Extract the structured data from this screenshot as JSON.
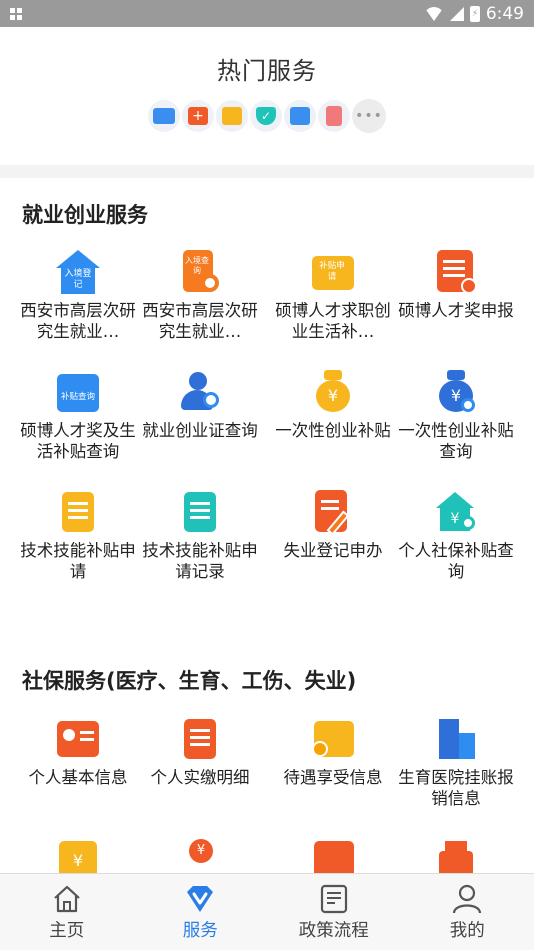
{
  "status_bar": {
    "time": "6:49"
  },
  "hot": {
    "title": "热门服务",
    "icons": [
      "id-card-icon",
      "medical-kit-icon",
      "folder-icon",
      "shield-check-icon",
      "calendar-icon",
      "document-icon"
    ],
    "more": "•••"
  },
  "sections": [
    {
      "title": "就业创业服务",
      "items": [
        {
          "label": "西安市高层次研究生就业…",
          "icon": "house-register-icon",
          "tag": "入境登记"
        },
        {
          "label": "西安市高层次研究生就业…",
          "icon": "document-search-icon",
          "tag": "入境查询"
        },
        {
          "label": "硕博人才求职创业生活补…",
          "icon": "ticket-icon",
          "tag": "补贴申请"
        },
        {
          "label": "硕博人才奖申报",
          "icon": "document-edit-icon"
        },
        {
          "label": "硕博人才奖及生活补贴查询",
          "icon": "folder-query-icon",
          "tag": "补贴查询"
        },
        {
          "label": "就业创业证查询",
          "icon": "user-search-icon"
        },
        {
          "label": "一次性创业补贴",
          "icon": "money-bag-icon"
        },
        {
          "label": "一次性创业补贴查询",
          "icon": "money-bag-search-icon"
        },
        {
          "label": "技术技能补贴申请",
          "icon": "clipboard-icon"
        },
        {
          "label": "技术技能补贴申请记录",
          "icon": "clipboard-list-icon"
        },
        {
          "label": "失业登记申办",
          "icon": "pen-document-icon"
        },
        {
          "label": "个人社保补贴查询",
          "icon": "house-money-icon"
        }
      ]
    },
    {
      "title": "社保服务(医疗、生育、工伤、失业)",
      "items": [
        {
          "label": "个人基本信息",
          "icon": "profile-card-icon"
        },
        {
          "label": "个人实缴明细",
          "icon": "clipboard-orange-icon"
        },
        {
          "label": "待遇享受信息",
          "icon": "wallet-coins-icon"
        },
        {
          "label": "生育医院挂账报销信息",
          "icon": "building-icon"
        },
        {
          "label": "",
          "icon": "calendar-money-icon"
        },
        {
          "label": "",
          "icon": "hand-money-icon"
        },
        {
          "label": "",
          "icon": "wallet-icon"
        },
        {
          "label": "",
          "icon": "printer-icon"
        }
      ]
    }
  ],
  "tabbar": [
    {
      "label": "主页",
      "icon": "home-icon",
      "active": false
    },
    {
      "label": "服务",
      "icon": "service-v-icon",
      "active": true
    },
    {
      "label": "政策流程",
      "icon": "policy-doc-icon",
      "active": false
    },
    {
      "label": "我的",
      "icon": "user-icon",
      "active": false
    }
  ],
  "colors": {
    "accent": "#2a7ee8",
    "orange": "#f57a20",
    "yellow": "#f7b61d",
    "teal": "#1fc1b8"
  }
}
